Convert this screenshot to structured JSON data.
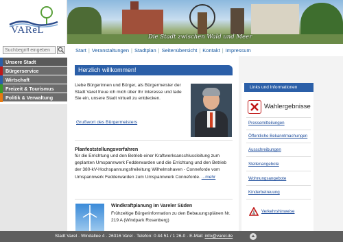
{
  "logo": {
    "text": "VAReL"
  },
  "banner": {
    "slogan": "Die Stadt zwischen Wald und Meer"
  },
  "search": {
    "placeholder": "Suchbegriff eingeben"
  },
  "nav": {
    "items": [
      {
        "label": "Unsere Stadt",
        "color": "#2b5fa8"
      },
      {
        "label": "Bürgerservice",
        "color": "#c01818"
      },
      {
        "label": "Wirtschaft",
        "color": "#2b5fa8"
      },
      {
        "label": "Freizeit & Tourismus",
        "color": "#3a9a2a"
      },
      {
        "label": "Politik & Verwaltung",
        "color": "#e87a10"
      }
    ]
  },
  "topmenu": {
    "items": [
      "Start",
      "Veranstaltungen",
      "Stadtplan",
      "Seitenübersicht",
      "Kontakt",
      "Impressum"
    ],
    "separator": "|"
  },
  "welcome": {
    "title": "Herzlich willkommen!",
    "intro": "Liebe Bürgerinnen und Bürger, als Bürgermeister der Stadt Varel freue ich mich über Ihr Interesse und lade Sie ein, unsere Stadt virtuell zu entdecken.",
    "greeting_link": "Grußwort des Bürgermeisters"
  },
  "planning": {
    "title": "Planfeststellungsverfahren",
    "text": "für die Errichtung und den Betrieb einer Kraftwerksanschlussleitung zum geplanten Umspannwerk Fedderwarden und die Errichtung und den Betrieb der 380-kV-Hochspannungsfreileitung Wilhelmshaven - Conneforde vom Umspannwerk Fedderwarden zum Umspannwerk Conneforde.",
    "more": "...mehr"
  },
  "wind": {
    "title": "Windkraftplanung im Vareler Süden",
    "text": "Frühzeitige Bürgerinformation zu den Bebauungsplänen Nr. 219 A (Windpark Rosenberg)"
  },
  "right": {
    "header": "Links und Informationen",
    "election": "Wahlergebnisse",
    "links": [
      "Pressemitteilungen",
      "Öffentliche Bekanntmachungen",
      "Ausschreibungen",
      "Stellenangebote",
      "Wohnungsangebote",
      "Kinderbetreuung"
    ],
    "traffic": "Verkehrshinweise"
  },
  "footer": {
    "text": "Stadt Varel · Windallee 4 · 26316 Varel · Telefon: 0 44 51 / 1 26-0 · E-Mail: ",
    "email": "info@varel.de"
  }
}
